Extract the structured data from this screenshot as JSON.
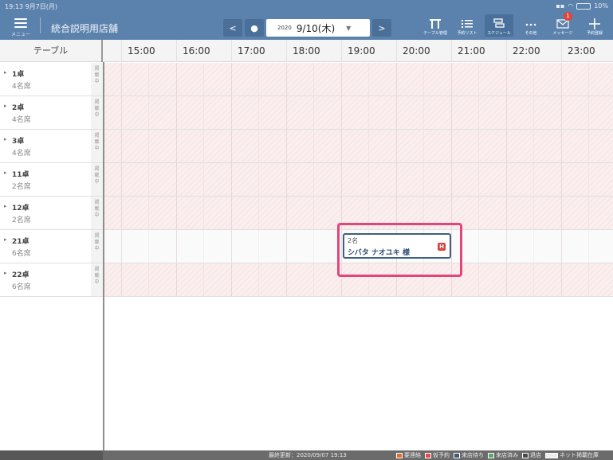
{
  "status": {
    "time": "19:13",
    "date": "9月7日(月)",
    "battery": "10%"
  },
  "header": {
    "menu_label": "メニュー",
    "store_name": "統合説明用店舗",
    "date_year": "2020",
    "date_main": "9/10(木)",
    "toolbar": [
      {
        "label": "テーブル管理",
        "icon": "table-icon"
      },
      {
        "label": "予約リスト",
        "icon": "list-icon"
      },
      {
        "label": "スケジュール",
        "icon": "schedule-icon"
      },
      {
        "label": "その他",
        "icon": "more-icon"
      },
      {
        "label": "メッセージ",
        "icon": "message-icon",
        "badge": "1"
      },
      {
        "label": "予約登録",
        "icon": "plus-icon"
      }
    ]
  },
  "columns": {
    "table_header": "テーブル",
    "hours": [
      "15:00",
      "16:00",
      "17:00",
      "18:00",
      "19:00",
      "20:00",
      "21:00",
      "22:00",
      "23:00"
    ]
  },
  "rows": [
    {
      "name": "1卓",
      "seats": "4名席"
    },
    {
      "name": "2卓",
      "seats": "4名席"
    },
    {
      "name": "3卓",
      "seats": "4名席"
    },
    {
      "name": "11卓",
      "seats": "2名席"
    },
    {
      "name": "12卓",
      "seats": "2名席"
    },
    {
      "name": "21卓",
      "seats": "6名席"
    },
    {
      "name": "22卓",
      "seats": "6名席"
    }
  ],
  "published_label": [
    "掲",
    "載",
    "中"
  ],
  "reservation": {
    "party": "2名",
    "name": "シバタ ナオユキ 様",
    "icon_letter": "H"
  },
  "footer": {
    "last_update": "最終更新：2020/09/07 19:13",
    "legend": [
      {
        "label": "要連絡",
        "color": "#e36b2e"
      },
      {
        "label": "仮予約",
        "color": "#e04a4a"
      },
      {
        "label": "来店待ち",
        "color": "#3b5b7e"
      },
      {
        "label": "来店済み",
        "color": "#5aa56a"
      },
      {
        "label": "退店",
        "color": "#4a4a4a"
      },
      {
        "label": "ネット掲載在庫",
        "color": "#eeeeee"
      }
    ]
  },
  "colors": {
    "header_bg": "#5b82ad",
    "accent_highlight": "#e2457a",
    "unavailable_bg": "#fbeeee"
  }
}
